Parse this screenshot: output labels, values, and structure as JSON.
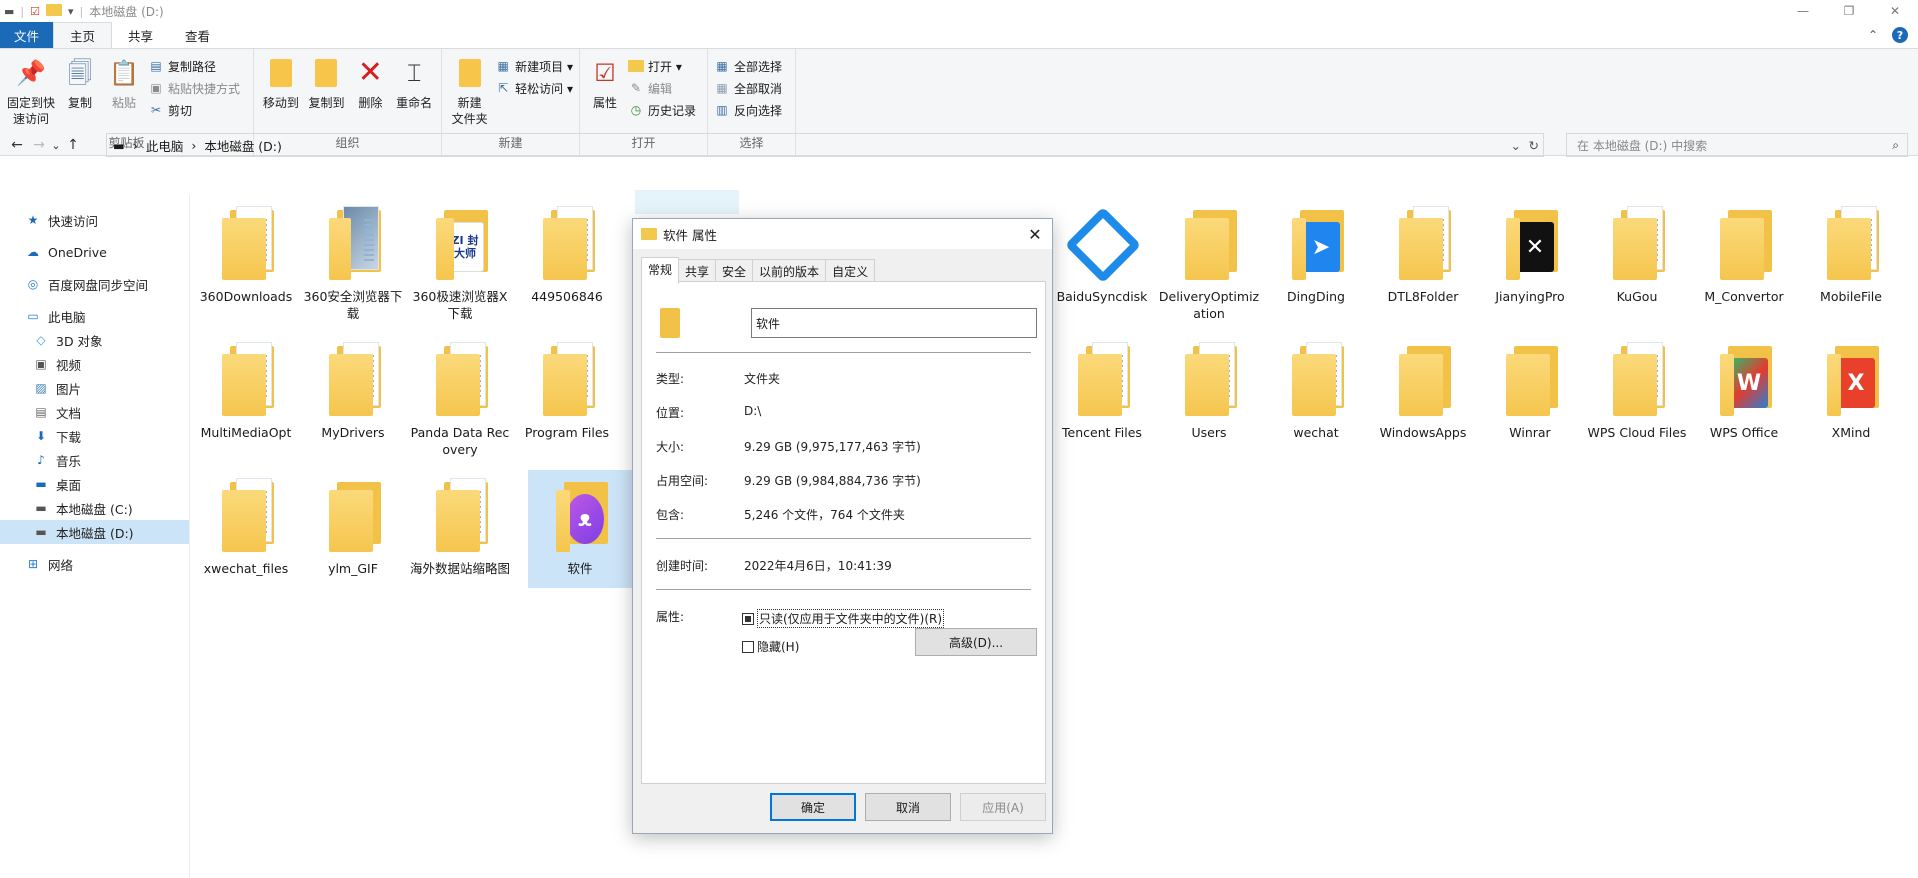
{
  "window": {
    "title": "本地磁盘 (D:)",
    "quick_access_sep": "|",
    "dropdown": "▾",
    "controls": {
      "minimize": "—",
      "maximize": "❐",
      "close": "✕"
    }
  },
  "ribbon_tabs": {
    "file": "文件",
    "home": "主页",
    "share": "共享",
    "view": "查看",
    "collapse": "⌃",
    "help": "?"
  },
  "ribbon": {
    "clipboard": {
      "pin": [
        "固定到快",
        "速访问"
      ],
      "copy": "复制",
      "paste": "粘贴",
      "copy_path": "复制路径",
      "paste_shortcut": "粘贴快捷方式",
      "cut": "剪切",
      "label": "剪贴板"
    },
    "organize": {
      "move_to": "移动到",
      "copy_to": "复制到",
      "delete": "删除",
      "rename": "重命名",
      "label": "组织"
    },
    "new": {
      "new_folder": [
        "新建",
        "文件夹"
      ],
      "new_item": "新建项目 ▾",
      "easy_access": "轻松访问 ▾",
      "label": "新建"
    },
    "open": {
      "properties": "属性",
      "open": "打开 ▾",
      "edit": "编辑",
      "history": "历史记录",
      "label": "打开"
    },
    "select": {
      "select_all": "全部选择",
      "select_none": "全部取消",
      "invert": "反向选择",
      "label": "选择"
    }
  },
  "nav": {
    "back": "←",
    "forward": "→",
    "recent": "⌄",
    "up": "↑",
    "breadcrumb": [
      "此电脑",
      "本地磁盘 (D:)"
    ],
    "crumb_sep": "›",
    "address_drop": "⌄",
    "refresh": "↻",
    "search_placeholder": "在 本地磁盘 (D:) 中搜索",
    "search_icon": "⌕"
  },
  "sidebar": {
    "items": [
      {
        "label": "快速访问",
        "icon": "star-icon"
      },
      {
        "label": "OneDrive",
        "icon": "cloud-icon"
      },
      {
        "label": "百度网盘同步空间",
        "icon": "baidu-icon"
      },
      {
        "label": "此电脑",
        "icon": "computer-icon"
      },
      {
        "label": "3D 对象",
        "icon": "cube-icon"
      },
      {
        "label": "视频",
        "icon": "video-icon"
      },
      {
        "label": "图片",
        "icon": "picture-icon"
      },
      {
        "label": "文档",
        "icon": "document-icon"
      },
      {
        "label": "下载",
        "icon": "download-icon"
      },
      {
        "label": "音乐",
        "icon": "music-icon"
      },
      {
        "label": "桌面",
        "icon": "desktop-icon"
      },
      {
        "label": "本地磁盘 (C:)",
        "icon": "drive-icon"
      },
      {
        "label": "本地磁盘 (D:)",
        "icon": "drive-icon"
      },
      {
        "label": "网络",
        "icon": "network-icon"
      }
    ]
  },
  "files": {
    "row1": [
      "360Downloads",
      "360安全浏览器下载",
      "360极速浏览器X下载",
      "449506846",
      "BaiduSyncdisk",
      "DeliveryOptimization",
      "DingDing",
      "DTL8Folder",
      "JianyingPro",
      "KuGou",
      "M_Convertor",
      "MobileFile"
    ],
    "row2": [
      "MultiMediaOpt",
      "MyDrivers",
      "Panda Data Recovery",
      "Program Files",
      "Tencent Files",
      "Users",
      "wechat",
      "WindowsApps",
      "Winrar",
      "WPS Cloud Files",
      "WPS Office",
      "XMind"
    ],
    "row3": [
      "xwechat_files",
      "ylm_GIF",
      "海外数据站缩略图",
      "软件"
    ],
    "emblem_text": "ZI 封大师"
  },
  "dialog": {
    "title": "软件 属性",
    "close": "✕",
    "tabs": [
      "常规",
      "共享",
      "安全",
      "以前的版本",
      "自定义"
    ],
    "name": "软件",
    "rows": {
      "type_k": "类型:",
      "type_v": "文件夹",
      "loc_k": "位置:",
      "loc_v": "D:\\",
      "size_k": "大小:",
      "size_v": "9.29 GB (9,975,177,463 字节)",
      "disk_k": "占用空间:",
      "disk_v": "9.29 GB (9,984,884,736 字节)",
      "contains_k": "包含:",
      "contains_v": "5,246 个文件，764 个文件夹",
      "created_k": "创建时间:",
      "created_v": "2022年4月6日，10:41:39",
      "attr_k": "属性:"
    },
    "readonly": "只读(仅应用于文件夹中的文件)(R)",
    "hidden": "隐藏(H)",
    "advanced": "高级(D)...",
    "ok": "确定",
    "cancel": "取消",
    "apply": "应用(A)"
  },
  "colors": {
    "accent": "#1a6ab8",
    "folder": "#f5c64e",
    "selection": "#cce4f7"
  }
}
